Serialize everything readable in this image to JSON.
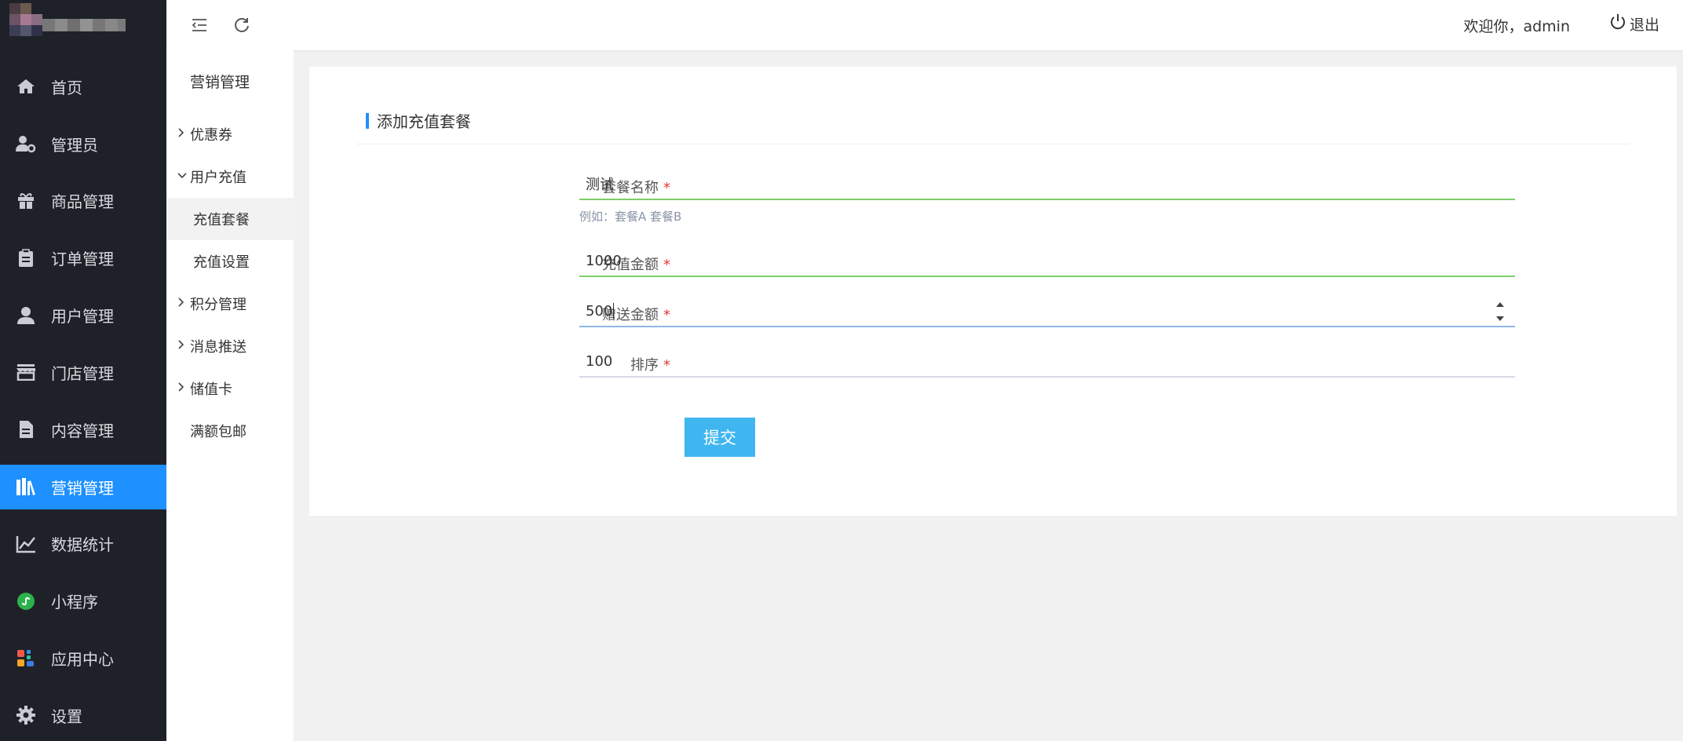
{
  "sidebar": {
    "items": [
      {
        "label": "首页",
        "icon": "home-icon"
      },
      {
        "label": "管理员",
        "icon": "admin-user-icon"
      },
      {
        "label": "商品管理",
        "icon": "gift-icon"
      },
      {
        "label": "订单管理",
        "icon": "clipboard-icon"
      },
      {
        "label": "用户管理",
        "icon": "user-icon"
      },
      {
        "label": "门店管理",
        "icon": "store-icon"
      },
      {
        "label": "内容管理",
        "icon": "document-icon"
      },
      {
        "label": "营销管理",
        "icon": "books-icon",
        "active": true
      },
      {
        "label": "数据统计",
        "icon": "line-chart-icon"
      },
      {
        "label": "小程序",
        "icon": "miniprogram-icon"
      },
      {
        "label": "应用中心",
        "icon": "apps-icon"
      },
      {
        "label": "设置",
        "icon": "gear-icon"
      }
    ],
    "active_color": "#1e90ff"
  },
  "submenu": {
    "title": "营销管理",
    "items": [
      {
        "label": "优惠券",
        "kind": "group-collapsed"
      },
      {
        "label": "用户充值",
        "kind": "group-expanded"
      },
      {
        "label": "充值套餐",
        "kind": "child",
        "active": true
      },
      {
        "label": "充值设置",
        "kind": "child"
      },
      {
        "label": "积分管理",
        "kind": "group-collapsed"
      },
      {
        "label": "消息推送",
        "kind": "group-collapsed"
      },
      {
        "label": "储值卡",
        "kind": "group-collapsed"
      },
      {
        "label": "满额包邮",
        "kind": "plain"
      }
    ]
  },
  "topbar": {
    "welcome": "欢迎你，admin",
    "logout": "退出"
  },
  "form": {
    "title": "添加充值套餐",
    "fields": {
      "name": {
        "label": "套餐名称",
        "value": "测试",
        "hint": "例如：套餐A 套餐B"
      },
      "amount": {
        "label": "充值金额",
        "value": "1000"
      },
      "bonus": {
        "label": "赠送金额",
        "value": "500"
      },
      "sort": {
        "label": "排序",
        "value": "100"
      }
    },
    "required_mark": "*",
    "submit": "提交"
  }
}
